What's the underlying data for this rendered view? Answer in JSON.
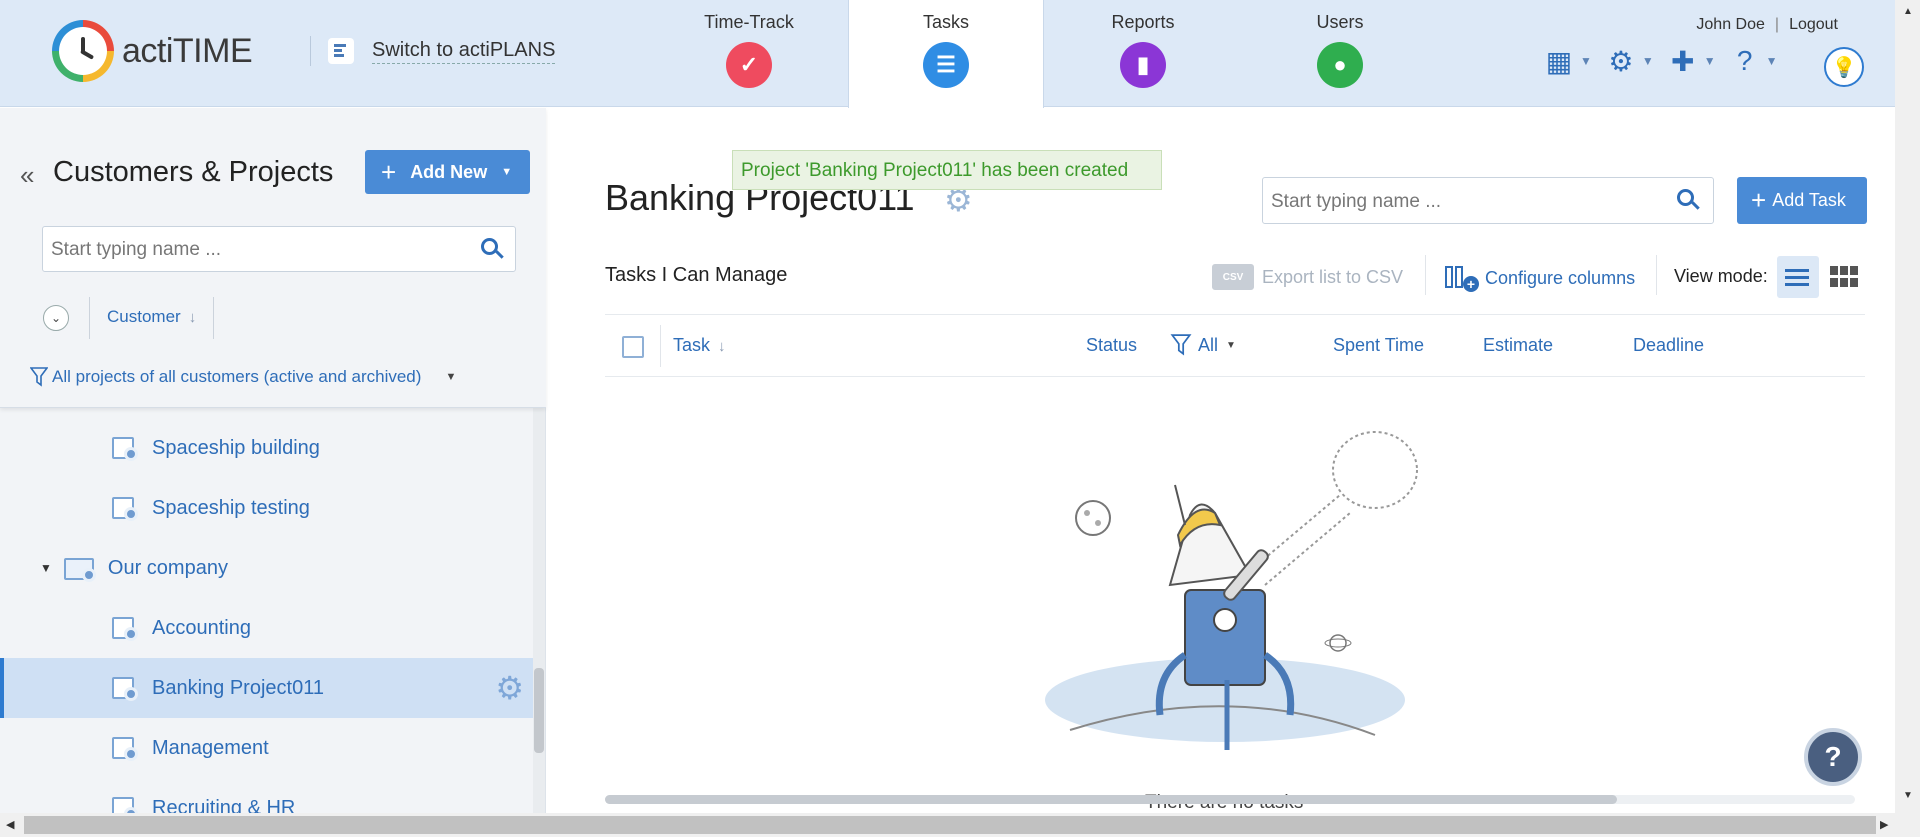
{
  "app": {
    "logo_text": "actiTIME",
    "switch_label": "Switch to actiPLANS"
  },
  "nav": {
    "tabs": [
      {
        "label": "Time-Track",
        "icon": "check-icon"
      },
      {
        "label": "Tasks",
        "icon": "list-icon",
        "active": true
      },
      {
        "label": "Reports",
        "icon": "bar-chart-icon"
      },
      {
        "label": "Users",
        "icon": "user-icon"
      }
    ]
  },
  "user": {
    "name": "John Doe",
    "separator": "|",
    "logout": "Logout"
  },
  "left_panel": {
    "title": "Customers & Projects",
    "add_new": "Add New",
    "search_placeholder": "Start typing name ...",
    "sort_column": "Customer",
    "filter_label": "All projects of all customers (active and archived)",
    "tree": [
      {
        "label": "Spaceship building",
        "type": "project"
      },
      {
        "label": "Spaceship testing",
        "type": "project"
      },
      {
        "label": "Our company",
        "type": "customer",
        "expanded": true
      },
      {
        "label": "Accounting",
        "type": "project"
      },
      {
        "label": "Banking Project011",
        "type": "project",
        "selected": true
      },
      {
        "label": "Management",
        "type": "project"
      },
      {
        "label": "Recruiting & HR",
        "type": "project"
      }
    ]
  },
  "main": {
    "notice": "Project 'Banking Project011' has been created",
    "project_title": "Banking Project011",
    "search_placeholder": "Start typing name ...",
    "add_task": "Add Task",
    "tasks_label": "Tasks I Can Manage",
    "csv_badge": "CSV",
    "export_csv": "Export list to CSV",
    "configure_columns": "Configure columns",
    "view_mode": "View mode:",
    "columns": {
      "task": "Task",
      "status": "Status",
      "status_filter": "All",
      "spent_time": "Spent Time",
      "estimate": "Estimate",
      "deadline": "Deadline"
    },
    "empty_text": "There are no tasks",
    "help_label": "?"
  },
  "colors": {
    "accent": "#4a8bd6",
    "link": "#2e6db8",
    "header_bg": "#dde9f7",
    "notice_text": "#3d9a2c"
  }
}
